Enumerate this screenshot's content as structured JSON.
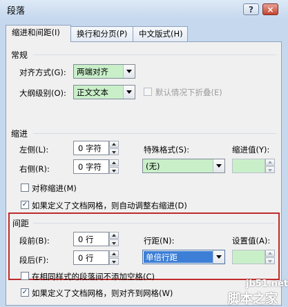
{
  "window": {
    "title": "段落",
    "help_glyph": "?",
    "close_glyph": "×"
  },
  "tabs": [
    {
      "label": "缩进和间距(I)",
      "active": true
    },
    {
      "label": "换行和分页(P)",
      "active": false
    },
    {
      "label": "中文版式(H)",
      "active": false
    }
  ],
  "general": {
    "heading": "常规",
    "alignment_label": "对齐方式(G):",
    "alignment_value": "两端对齐",
    "outline_label": "大纲级别(O):",
    "outline_value": "正文文本",
    "collapse_label": "默认情况下折叠(E)"
  },
  "indent": {
    "heading": "缩进",
    "left_label": "左侧(L):",
    "left_value": "0 字符",
    "right_label": "右侧(R):",
    "right_value": "0 字符",
    "special_label": "特殊格式(S):",
    "special_value": "(无)",
    "by_label": "缩进值(Y):",
    "by_value": "",
    "mirror_label": "对称缩进(M)",
    "mirror_checked": false,
    "auto_adjust_label": "如果定义了文档网格，则自动调整右缩进(D)",
    "auto_adjust_checked": true
  },
  "spacing": {
    "heading": "间距",
    "before_label": "段前(B):",
    "before_value": "0 行",
    "after_label": "段后(F):",
    "after_value": "0 行",
    "line_label": "行距(N):",
    "line_value": "单倍行距",
    "at_label": "设置值(A):",
    "at_value": "",
    "no_space_label": "在相同样式的段落间不添加空格(C)",
    "no_space_checked": false,
    "snap_grid_label": "如果定义了文档网格，则对齐到网格(W)",
    "snap_grid_checked": true
  },
  "checkmark": "✓",
  "watermark": {
    "site": "jb51.net",
    "name": "脚本之家"
  }
}
